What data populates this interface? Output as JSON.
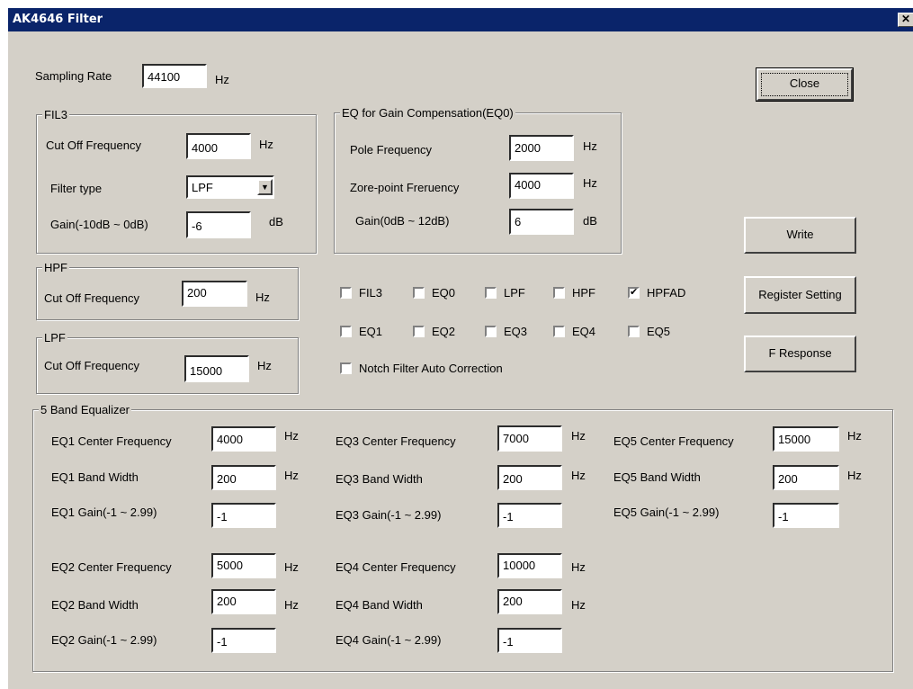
{
  "window": {
    "title": "AK4646 Filter",
    "close_glyph": "✕"
  },
  "top": {
    "sampling_label": "Sampling Rate",
    "sampling_value": "44100",
    "sampling_unit": "Hz",
    "close_button": "Close"
  },
  "fil3": {
    "group_label": "FIL3",
    "cutoff_label": "Cut Off Frequency",
    "cutoff_value": "4000",
    "cutoff_unit": "Hz",
    "type_label": "Filter type",
    "type_value": "LPF",
    "gain_label": "Gain(-10dB ~ 0dB)",
    "gain_value": "-6",
    "gain_unit": "dB"
  },
  "eq0": {
    "group_label": "EQ for Gain Compensation(EQ0)",
    "pole_label": "Pole Frequency",
    "pole_value": "2000",
    "pole_unit": "Hz",
    "zero_label": "Zore-point Freruency",
    "zero_value": "4000",
    "zero_unit": "Hz",
    "gain_label": "Gain(0dB ~ 12dB)",
    "gain_value": "6",
    "gain_unit": "dB"
  },
  "hpf": {
    "group_label": "HPF",
    "cutoff_label": "Cut Off Frequency",
    "cutoff_value": "200",
    "cutoff_unit": "Hz"
  },
  "lpf": {
    "group_label": "LPF",
    "cutoff_label": "Cut Off Frequency",
    "cutoff_value": "15000",
    "cutoff_unit": "Hz"
  },
  "checkboxes": {
    "fil3": {
      "label": "FIL3",
      "checked": false
    },
    "eq0": {
      "label": "EQ0",
      "checked": false
    },
    "lpf": {
      "label": "LPF",
      "checked": false
    },
    "hpf": {
      "label": "HPF",
      "checked": false
    },
    "hpfad": {
      "label": "HPFAD",
      "checked": true
    },
    "eq1": {
      "label": "EQ1",
      "checked": false
    },
    "eq2": {
      "label": "EQ2",
      "checked": false
    },
    "eq3": {
      "label": "EQ3",
      "checked": false
    },
    "eq4": {
      "label": "EQ4",
      "checked": false
    },
    "eq5": {
      "label": "EQ5",
      "checked": false
    },
    "notch": {
      "label": "Notch Filter Auto Correction",
      "checked": false
    },
    "check_glyph": "✔"
  },
  "buttons": {
    "write": "Write",
    "register": "Register Setting",
    "fresponse": "F Response"
  },
  "eq5band": {
    "group_label": "5 Band Equalizer",
    "hz": "Hz",
    "eq1": {
      "center_label": "EQ1 Center Frequency",
      "center_value": "4000",
      "bw_label": "EQ1 Band Width",
      "bw_value": "200",
      "gain_label": "EQ1 Gain(-1 ~ 2.99)",
      "gain_value": "-1"
    },
    "eq2": {
      "center_label": "EQ2 Center Frequency",
      "center_value": "5000",
      "bw_label": "EQ2 Band Width",
      "bw_value": "200",
      "gain_label": "EQ2 Gain(-1 ~ 2.99)",
      "gain_value": "-1"
    },
    "eq3": {
      "center_label": "EQ3 Center Frequency",
      "center_value": "7000",
      "bw_label": "EQ3 Band Width",
      "bw_value": "200",
      "gain_label": "EQ3 Gain(-1 ~ 2.99)",
      "gain_value": "-1"
    },
    "eq4": {
      "center_label": "EQ4 Center Frequency",
      "center_value": "10000",
      "bw_label": "EQ4 Band Width",
      "bw_value": "200",
      "gain_label": "EQ4 Gain(-1 ~ 2.99)",
      "gain_value": "-1"
    },
    "eq5": {
      "center_label": "EQ5 Center Frequency",
      "center_value": "15000",
      "bw_label": "EQ5 Band Width",
      "bw_value": "200",
      "gain_label": "EQ5 Gain(-1 ~ 2.99)",
      "gain_value": "-1"
    }
  }
}
